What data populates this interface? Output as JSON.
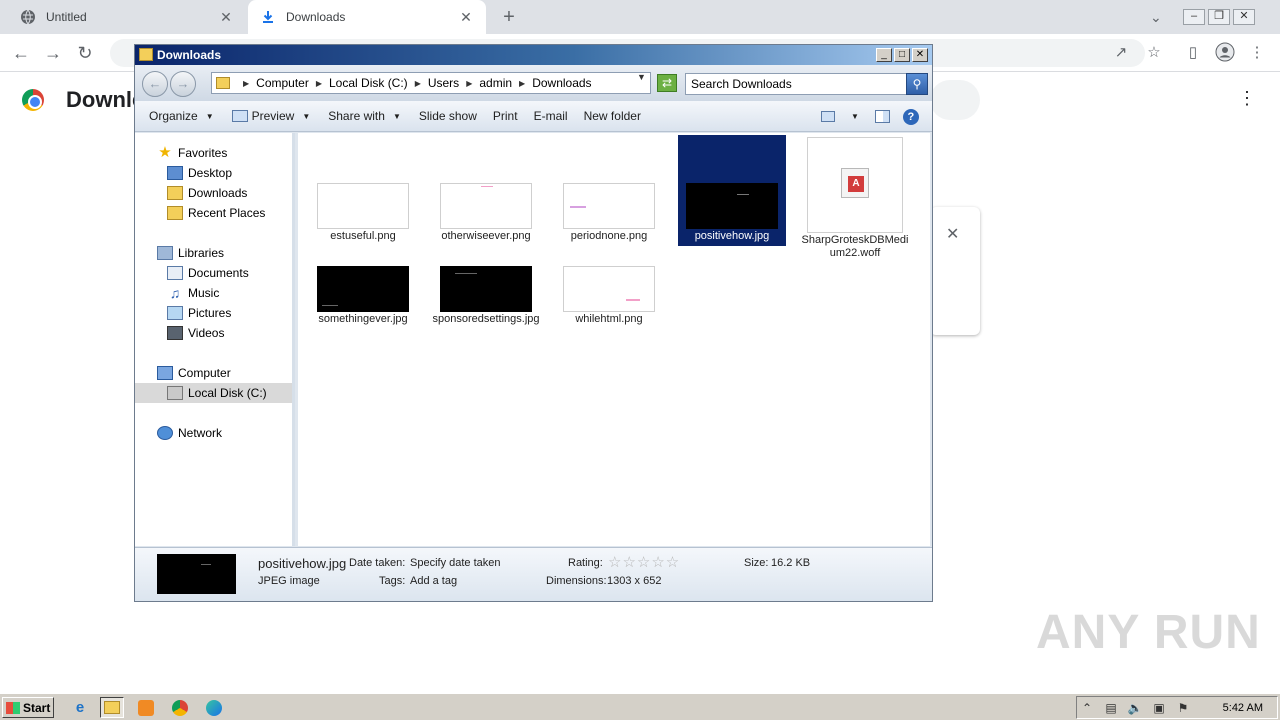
{
  "browser": {
    "tabs": [
      {
        "label": "Untitled",
        "close": "✕"
      },
      {
        "label": "Downloads",
        "close": "✕"
      }
    ],
    "new_tab": "+",
    "page_title": "Downle",
    "card_close": "✕"
  },
  "explorer": {
    "title": "Downloads",
    "breadcrumbs": [
      "Computer",
      "Local Disk (C:)",
      "Users",
      "admin",
      "Downloads"
    ],
    "search_placeholder": "Search Downloads",
    "commands": {
      "organize": "Organize",
      "preview": "Preview",
      "share_with": "Share with",
      "slide_show": "Slide show",
      "print": "Print",
      "email": "E-mail",
      "new_folder": "New folder",
      "help": "?"
    },
    "nav": {
      "favorites": "Favorites",
      "desktop": "Desktop",
      "downloads": "Downloads",
      "recent_places": "Recent Places",
      "libraries": "Libraries",
      "documents": "Documents",
      "music": "Music",
      "pictures": "Pictures",
      "videos": "Videos",
      "computer": "Computer",
      "local_disk": "Local Disk (C:)",
      "network": "Network"
    },
    "files": [
      {
        "name": "estuseful.png",
        "thumb": "white"
      },
      {
        "name": "otherwiseever.png",
        "thumb": "white"
      },
      {
        "name": "periodnone.png",
        "thumb": "white"
      },
      {
        "name": "positivehow.jpg",
        "thumb": "black",
        "selected": true
      },
      {
        "name": "SharpGroteskDBMedium22.woff",
        "thumb": "font"
      },
      {
        "name": "somethingever.jpg",
        "thumb": "black"
      },
      {
        "name": "sponsoredsettings.jpg",
        "thumb": "black"
      },
      {
        "name": "whilehtml.png",
        "thumb": "white"
      }
    ],
    "details": {
      "filename": "positivehow.jpg",
      "type": "JPEG image",
      "date_taken_label": "Date taken:",
      "date_taken_value": "Specify date taken",
      "tags_label": "Tags:",
      "tags_value": "Add a tag",
      "rating_label": "Rating:",
      "rating_stars": "☆☆☆☆☆",
      "dimensions_label": "Dimensions:",
      "dimensions_value": "1303 x 652",
      "size_label": "Size:",
      "size_value": "16.2 KB"
    }
  },
  "taskbar": {
    "start": "Start",
    "clock": "5:42 AM"
  },
  "watermark": "ANY RUN"
}
